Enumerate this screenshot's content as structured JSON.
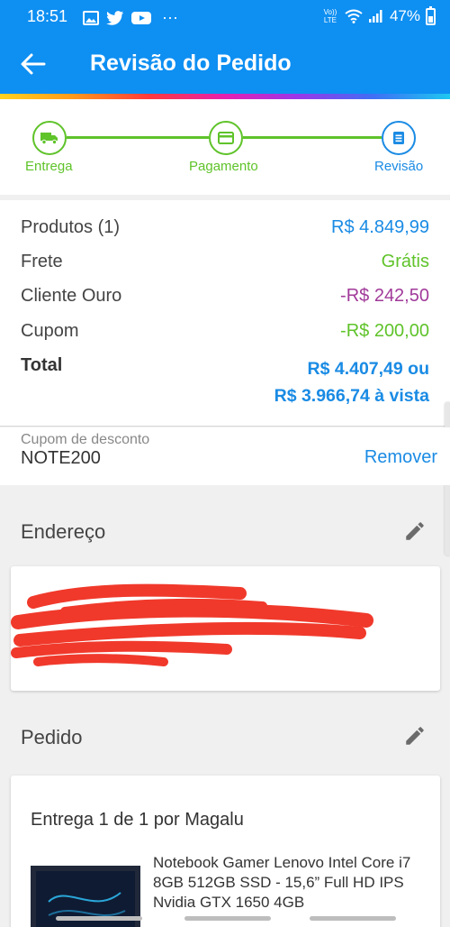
{
  "status_bar": {
    "time": "18:51",
    "more": "···",
    "network_label": "Vo)) LTE",
    "battery": "47%"
  },
  "app_bar": {
    "title": "Revisão do Pedido",
    "back_icon": "arrow-left-icon"
  },
  "stepper": {
    "steps": [
      {
        "label": "Entrega",
        "icon": "truck-icon",
        "state": "done"
      },
      {
        "label": "Pagamento",
        "icon": "credit-card-icon",
        "state": "done"
      },
      {
        "label": "Revisão",
        "icon": "document-icon",
        "state": "active"
      }
    ]
  },
  "summary": {
    "products_label": "Produtos (1)",
    "products_value": "R$ 4.849,99",
    "shipping_label": "Frete",
    "shipping_value": "Grátis",
    "gold_label": "Cliente Ouro",
    "gold_value": "-R$ 242,50",
    "coupon_label": "Cupom",
    "coupon_value": "-R$ 200,00",
    "total_label": "Total",
    "total_installment": "R$ 4.407,49 ou",
    "total_cash": "R$ 3.966,74 à vista"
  },
  "coupon": {
    "label": "Cupom de desconto",
    "code": "NOTE200",
    "remove_label": "Remover"
  },
  "address": {
    "title": "Endereço"
  },
  "order": {
    "title": "Pedido",
    "delivery_title": "Entrega 1 de 1 por Magalu",
    "product_name": "Notebook Gamer Lenovo Intel Core i7 8GB 512GB SSD - 15,6” Full HD IPS Nvidia GTX 1650 4GB"
  },
  "colors": {
    "brand_blue": "#0e8ff2",
    "link_blue": "#1a8be4",
    "success_green": "#5fc32a",
    "discount_purple": "#a13a9a",
    "redaction_red": "#f0392b"
  }
}
